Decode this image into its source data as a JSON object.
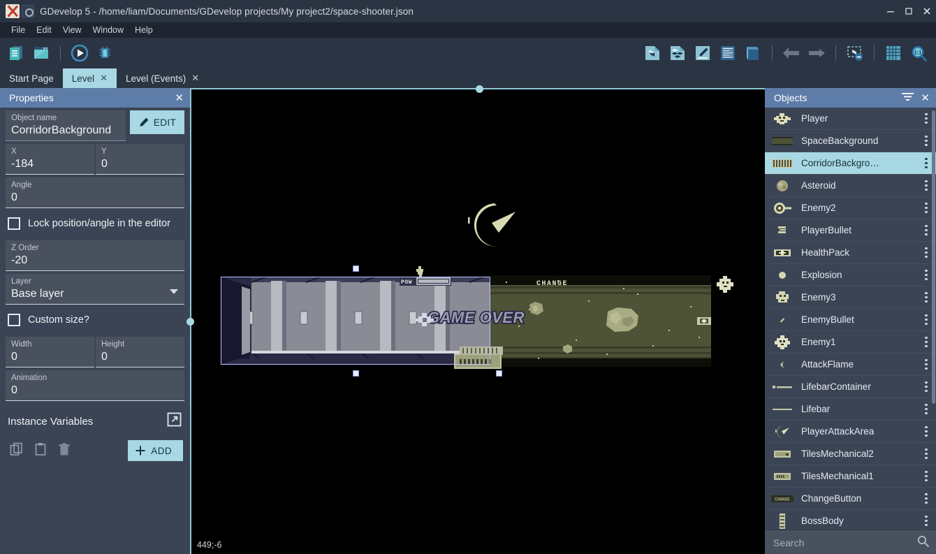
{
  "window": {
    "title": "GDevelop 5 - /home/liam/Documents/GDevelop projects/My project2/space-shooter.json",
    "minimize_label": "–",
    "maximize_label": "□",
    "close_label": "✕"
  },
  "menu": {
    "items": [
      {
        "label": "File"
      },
      {
        "label": "Edit"
      },
      {
        "label": "View"
      },
      {
        "label": "Window"
      },
      {
        "label": "Help"
      }
    ]
  },
  "toolbar": {
    "left": [
      {
        "name": "project-manager-icon",
        "label": "Project Manager"
      },
      {
        "name": "open-scene-icon",
        "label": "Open Scene"
      },
      {
        "name": "preview-play-icon",
        "label": "Preview"
      },
      {
        "name": "debug-icon",
        "label": "Debug"
      }
    ],
    "right": [
      {
        "name": "add-object-icon",
        "label": "Add a new object"
      },
      {
        "name": "add-objects-group-icon",
        "label": "Add a new object group"
      },
      {
        "name": "edit-instances-icon",
        "label": "Edit instances"
      },
      {
        "name": "open-objects-list-icon",
        "label": "Open objects list"
      },
      {
        "name": "open-layers-list-icon",
        "label": "Open layers list"
      },
      {
        "name": "undo-icon",
        "label": "Undo"
      },
      {
        "name": "redo-icon",
        "label": "Redo"
      },
      {
        "name": "toggle-instances-selection-icon",
        "label": "Toggle instances selection"
      },
      {
        "name": "toggle-grid-icon",
        "label": "Toggle grid"
      },
      {
        "name": "zoom-reset-icon",
        "label": "Zoom 1:1",
        "badge": "1:1"
      }
    ]
  },
  "tabs": [
    {
      "label": "Start Page",
      "active": false,
      "closable": false
    },
    {
      "label": "Level",
      "active": true,
      "closable": true,
      "close_label": "✕"
    },
    {
      "label": "Level (Events)",
      "active": false,
      "closable": true,
      "close_label": "✕"
    }
  ],
  "properties": {
    "title": "Properties",
    "close_label": "✕",
    "object_name": {
      "label": "Object name",
      "value": "CorridorBackground"
    },
    "edit_button": "EDIT",
    "x": {
      "label": "X",
      "value": "-184"
    },
    "y": {
      "label": "Y",
      "value": "0"
    },
    "angle": {
      "label": "Angle",
      "value": "0"
    },
    "lock_checkbox": {
      "label": "Lock position/angle in the editor",
      "checked": false
    },
    "z_order": {
      "label": "Z Order",
      "value": "-20"
    },
    "layer": {
      "label": "Layer",
      "value": "Base layer"
    },
    "custom_size": {
      "label": "Custom size?",
      "checked": false
    },
    "width": {
      "label": "Width",
      "value": "0"
    },
    "height": {
      "label": "Height",
      "value": "0"
    },
    "animation": {
      "label": "Animation",
      "value": "0"
    },
    "instance_variables": {
      "title": "Instance Variables",
      "open_label": "Open in a larger window"
    },
    "variable_actions": [
      {
        "name": "copy-icon",
        "label": "Copy"
      },
      {
        "name": "paste-icon",
        "label": "Paste"
      },
      {
        "name": "delete-icon",
        "label": "Delete"
      }
    ],
    "add_button": "ADD"
  },
  "canvas": {
    "coordinates": "449;-6",
    "background_color": "#000000",
    "selection": {
      "object": "CorridorBackground"
    }
  },
  "objects_panel": {
    "title": "Objects",
    "filter_label": "Filter",
    "close_label": "✕",
    "search_placeholder": "Search",
    "items": [
      {
        "label": "Player",
        "icon": "player-sprite",
        "selected": false
      },
      {
        "label": "SpaceBackground",
        "icon": "space-background-sprite",
        "selected": false
      },
      {
        "label": "CorridorBackgro…",
        "icon": "corridor-background-sprite",
        "selected": true
      },
      {
        "label": "Asteroid",
        "icon": "asteroid-sprite",
        "selected": false
      },
      {
        "label": "Enemy2",
        "icon": "enemy2-sprite",
        "selected": false
      },
      {
        "label": "PlayerBullet",
        "icon": "player-bullet-sprite",
        "selected": false
      },
      {
        "label": "HealthPack",
        "icon": "health-pack-sprite",
        "selected": false
      },
      {
        "label": "Explosion",
        "icon": "explosion-sprite",
        "selected": false
      },
      {
        "label": "Enemy3",
        "icon": "enemy3-sprite",
        "selected": false
      },
      {
        "label": "EnemyBullet",
        "icon": "enemy-bullet-sprite",
        "selected": false
      },
      {
        "label": "Enemy1",
        "icon": "enemy1-sprite",
        "selected": false
      },
      {
        "label": "AttackFlame",
        "icon": "attack-flame-sprite",
        "selected": false
      },
      {
        "label": "LifebarContainer",
        "icon": "lifebar-container-sprite",
        "selected": false
      },
      {
        "label": "Lifebar",
        "icon": "lifebar-sprite",
        "selected": false
      },
      {
        "label": "PlayerAttackArea",
        "icon": "player-attack-area-sprite",
        "selected": false
      },
      {
        "label": "TilesMechanical2",
        "icon": "tiles-mechanical2-sprite",
        "selected": false
      },
      {
        "label": "TilesMechanical1",
        "icon": "tiles-mechanical1-sprite",
        "selected": false
      },
      {
        "label": "ChangeButton",
        "icon": "change-button-sprite",
        "selected": false
      },
      {
        "label": "BossBody",
        "icon": "boss-body-sprite",
        "selected": false
      }
    ]
  },
  "scene_text": {
    "pow_label": "POW",
    "change_label": "CHANGE",
    "game_over_label": "GAME OVER"
  },
  "colors": {
    "accent": "#a7d8e3",
    "panel_header": "#5e7ca8",
    "panel_bg": "#3b4455",
    "field_bg": "#49515f",
    "titlebar": "#2b3442",
    "menubar": "#1e2430",
    "selection_outline": "#b9c0ff",
    "sprite_olive": "#d6d6b0"
  }
}
